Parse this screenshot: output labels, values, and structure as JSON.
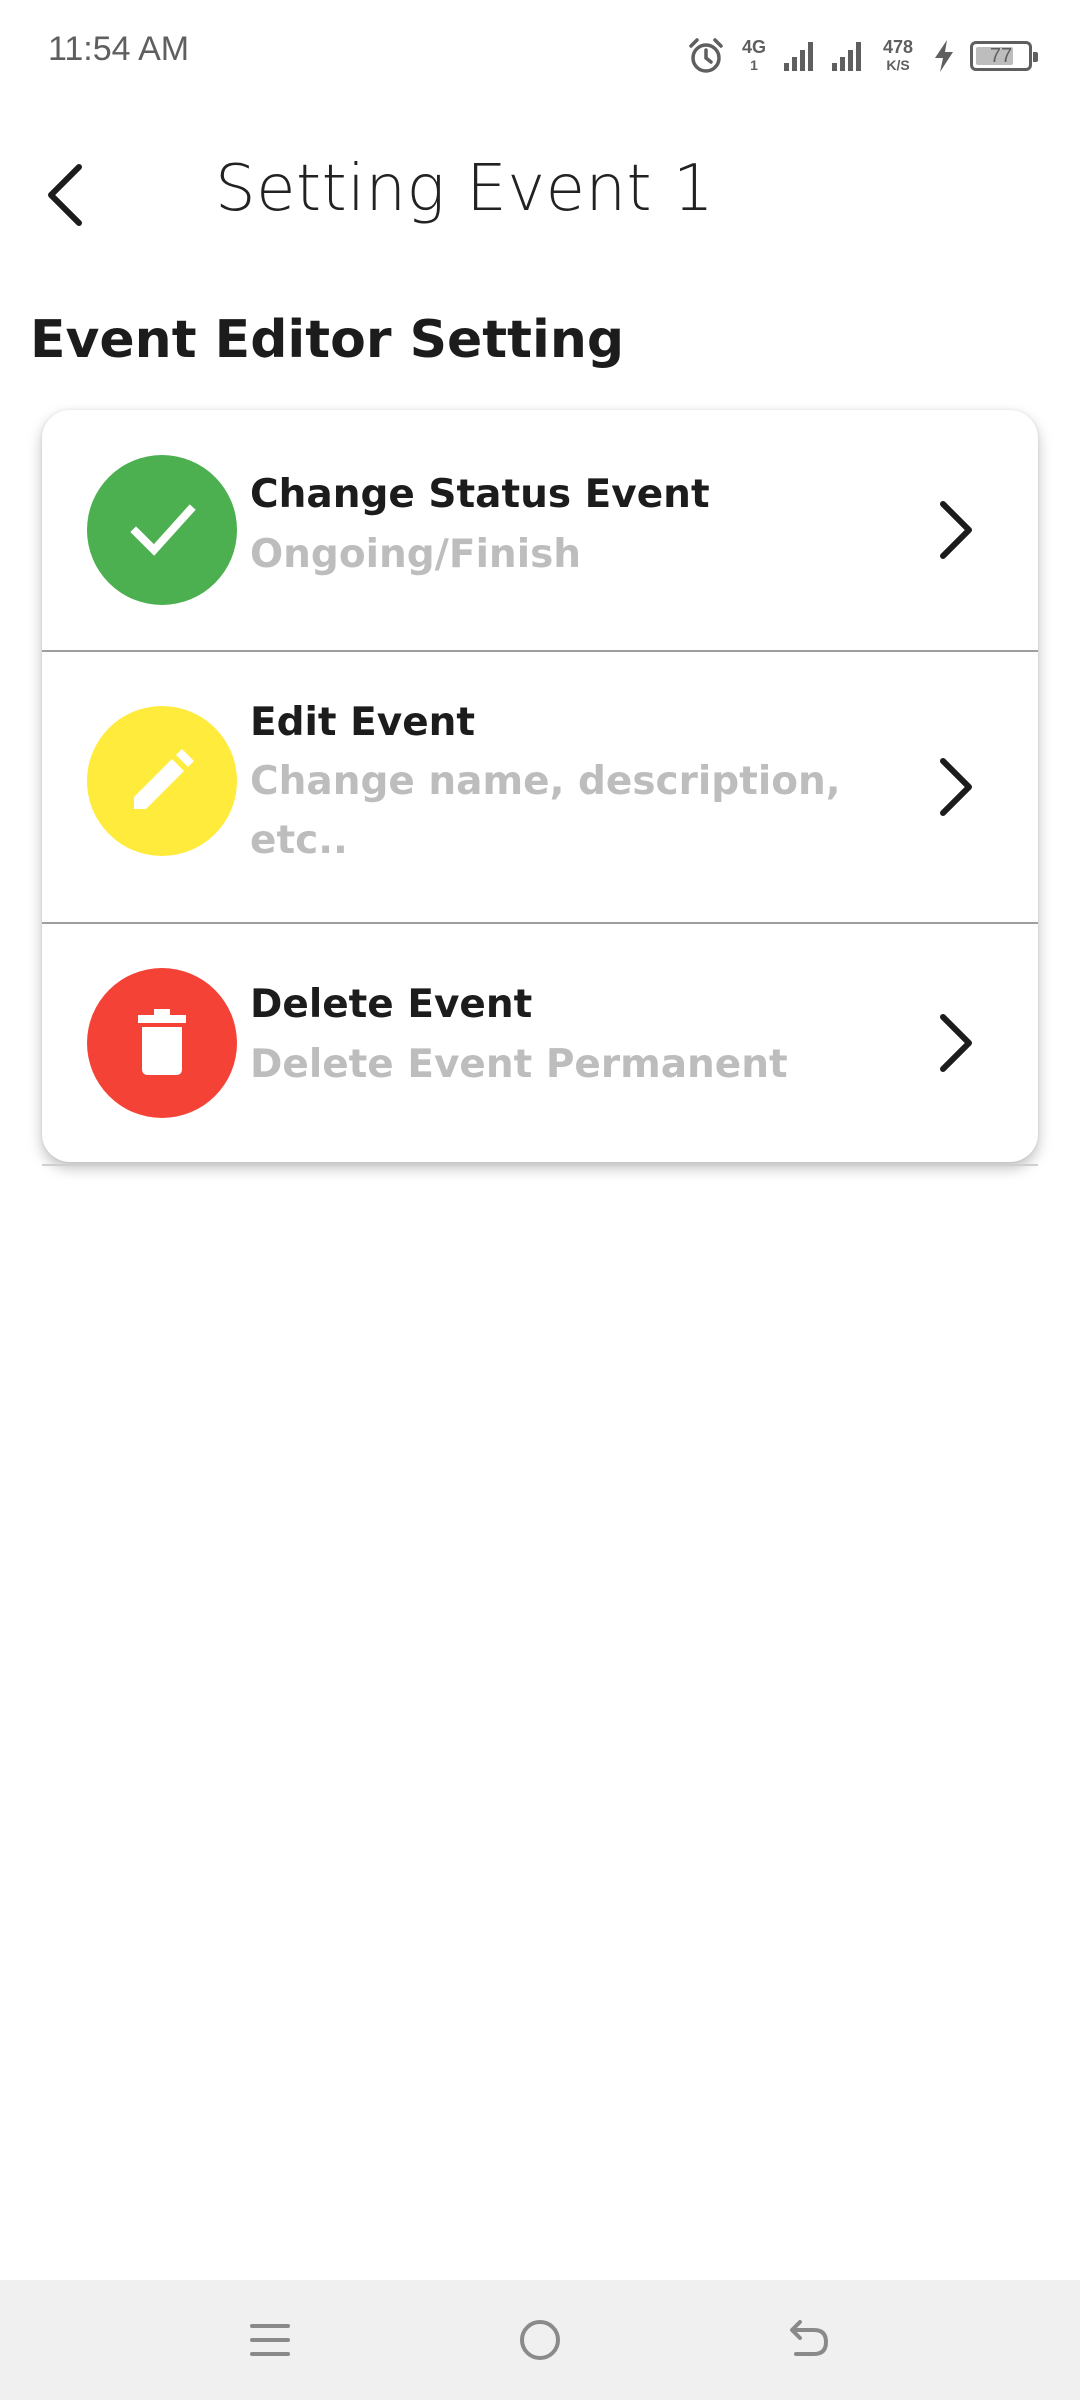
{
  "status_bar": {
    "time": "11:54 AM",
    "network_type": "4G",
    "network_sub": "1",
    "speed_value": "478",
    "speed_unit": "K/S",
    "battery_level": "77",
    "icons": [
      "alarm-icon",
      "signal-icon",
      "signal-icon",
      "charging-icon",
      "battery-icon"
    ]
  },
  "header": {
    "back_icon": "back-arrow-icon",
    "title": "Setting Event 1"
  },
  "section": {
    "title": "Event Editor Setting"
  },
  "items": [
    {
      "title": "Change Status Event",
      "subtitle": "Ongoing/Finish",
      "icon": "check-icon",
      "color": "#4caf50"
    },
    {
      "title": "Edit Event",
      "subtitle": "Change name, description, etc..",
      "icon": "pencil-icon",
      "color": "#ffeb3b"
    },
    {
      "title": "Delete Event",
      "subtitle": "Delete Event Permanent",
      "icon": "trash-icon",
      "color": "#f44336"
    }
  ],
  "nav_bar": {
    "buttons": [
      "menu-icon",
      "home-icon",
      "back-icon"
    ]
  }
}
